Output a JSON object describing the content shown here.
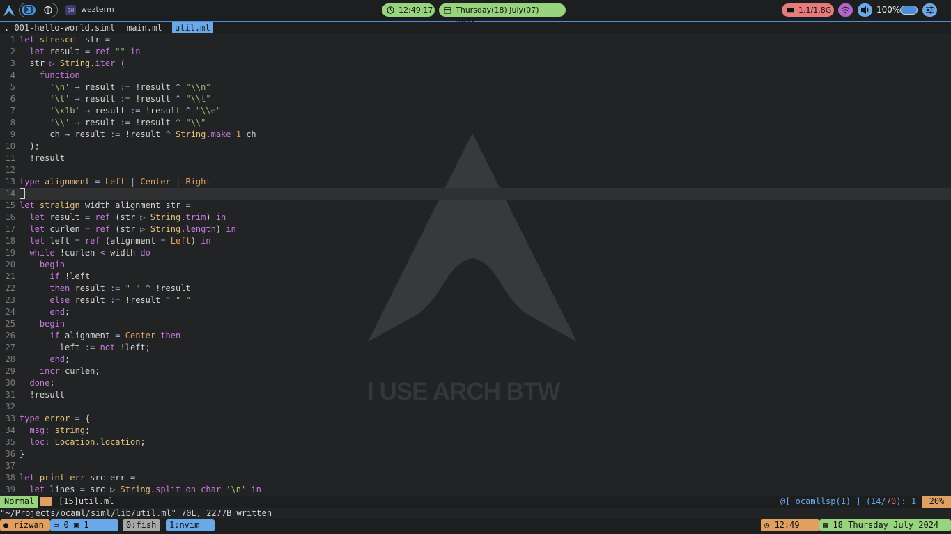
{
  "app": {
    "title": "wezterm",
    "icon_text": "$W"
  },
  "bar": {
    "clock": "12:49:17",
    "date": "Thursday(18) July(07) 2024",
    "memory": "1.1/1.8G",
    "battery": "100%",
    "icons": [
      "arch-logo-icon",
      "terminal-icon",
      "globe-icon",
      "clock-icon",
      "calendar-icon",
      "memory-icon",
      "wifi-icon",
      "volume-icon",
      "battery-icon",
      "settings-icon"
    ]
  },
  "tabs": [
    {
      "label": ".  001-hello-world.siml"
    },
    {
      "label": "main.ml"
    },
    {
      "label": "util.ml",
      "active": true
    }
  ],
  "colors": {
    "accent": "#4a90d9",
    "green": "#98d37e",
    "orange": "#e0a060",
    "red": "#e57b7b",
    "purple": "#c678dd",
    "yellow": "#e5c07b"
  },
  "editor": {
    "lines": [
      [
        [
          "k",
          "let "
        ],
        [
          "t",
          "strescc"
        ],
        [
          "",
          "  str "
        ],
        [
          "o",
          "="
        ]
      ],
      [
        [
          "",
          "  "
        ],
        [
          "k",
          "let "
        ],
        [
          "",
          "result "
        ],
        [
          "o",
          "= "
        ],
        [
          "k",
          "ref "
        ],
        [
          "s",
          "\"\""
        ],
        [
          "k",
          " in"
        ]
      ],
      [
        [
          "",
          "  str "
        ],
        [
          "o",
          "▷ "
        ],
        [
          "t",
          "String"
        ],
        [
          "",
          "."
        ],
        [
          "k",
          "iter"
        ],
        [
          "",
          ""
        ],
        [
          "o",
          " ("
        ]
      ],
      [
        [
          "",
          "    "
        ],
        [
          "k",
          "function"
        ]
      ],
      [
        [
          "",
          "    "
        ],
        [
          "o",
          "| "
        ],
        [
          "s",
          "'\\n'"
        ],
        [
          "o",
          " → "
        ],
        [
          "",
          "result "
        ],
        [
          "o",
          ":= "
        ],
        [
          "",
          "!result "
        ],
        [
          "o",
          "^ "
        ],
        [
          "s",
          "\"\\\\n\""
        ]
      ],
      [
        [
          "",
          "    "
        ],
        [
          "o",
          "| "
        ],
        [
          "s",
          "'\\t'"
        ],
        [
          "o",
          " → "
        ],
        [
          "",
          "result "
        ],
        [
          "o",
          ":= "
        ],
        [
          "",
          "!result "
        ],
        [
          "o",
          "^ "
        ],
        [
          "s",
          "\"\\\\t\""
        ]
      ],
      [
        [
          "",
          "    "
        ],
        [
          "o",
          "| "
        ],
        [
          "s",
          "'\\x1b'"
        ],
        [
          "o",
          " → "
        ],
        [
          "",
          "result "
        ],
        [
          "o",
          ":= "
        ],
        [
          "",
          "!result "
        ],
        [
          "o",
          "^ "
        ],
        [
          "s",
          "\"\\\\e\""
        ]
      ],
      [
        [
          "",
          "    "
        ],
        [
          "o",
          "| "
        ],
        [
          "s",
          "'\\\\'"
        ],
        [
          "o",
          " → "
        ],
        [
          "",
          "result "
        ],
        [
          "o",
          ":= "
        ],
        [
          "",
          "!result "
        ],
        [
          "o",
          "^ "
        ],
        [
          "s",
          "\"\\\\\""
        ]
      ],
      [
        [
          "",
          "    "
        ],
        [
          "o",
          "| "
        ],
        [
          "",
          "ch "
        ],
        [
          "o",
          "→ "
        ],
        [
          "",
          "result "
        ],
        [
          "o",
          ":= "
        ],
        [
          "",
          "!result "
        ],
        [
          "o",
          "^ "
        ],
        [
          "t",
          "String"
        ],
        [
          "",
          "."
        ],
        [
          "k",
          "make "
        ],
        [
          "c",
          "1"
        ],
        [
          "",
          " ch"
        ]
      ],
      [
        [
          "",
          "  );"
        ]
      ],
      [
        [
          "",
          "  !result"
        ]
      ],
      [],
      [
        [
          "k",
          "type "
        ],
        [
          "t",
          "alignment "
        ],
        [
          "o",
          "= "
        ],
        [
          "c",
          "Left "
        ],
        [
          "o",
          "| "
        ],
        [
          "c",
          "Center "
        ],
        [
          "o",
          "| "
        ],
        [
          "c",
          "Right"
        ]
      ],
      [],
      [
        [
          "k",
          "let "
        ],
        [
          "t",
          "stralign "
        ],
        [
          "",
          "width alignment str "
        ],
        [
          "o",
          "="
        ]
      ],
      [
        [
          "",
          "  "
        ],
        [
          "k",
          "let "
        ],
        [
          "",
          "result "
        ],
        [
          "o",
          "= "
        ],
        [
          "k",
          "ref "
        ],
        [
          "",
          "(str "
        ],
        [
          "o",
          "▷ "
        ],
        [
          "t",
          "String"
        ],
        [
          "",
          "."
        ],
        [
          "k",
          "trim"
        ],
        [
          "",
          ") "
        ],
        [
          "k",
          "in"
        ]
      ],
      [
        [
          "",
          "  "
        ],
        [
          "k",
          "let "
        ],
        [
          "",
          "curlen "
        ],
        [
          "o",
          "= "
        ],
        [
          "k",
          "ref "
        ],
        [
          "",
          "(str "
        ],
        [
          "o",
          "▷ "
        ],
        [
          "t",
          "String"
        ],
        [
          "",
          "."
        ],
        [
          "k",
          "length"
        ],
        [
          "",
          ") "
        ],
        [
          "k",
          "in"
        ]
      ],
      [
        [
          "",
          "  "
        ],
        [
          "k",
          "let "
        ],
        [
          "",
          "left "
        ],
        [
          "o",
          "= "
        ],
        [
          "k",
          "ref "
        ],
        [
          "",
          "(alignment "
        ],
        [
          "o",
          "= "
        ],
        [
          "c",
          "Left"
        ],
        [
          "",
          ") "
        ],
        [
          "k",
          "in"
        ]
      ],
      [
        [
          "",
          "  "
        ],
        [
          "k",
          "while "
        ],
        [
          "",
          "!curlen "
        ],
        [
          "o",
          "< "
        ],
        [
          "",
          "width "
        ],
        [
          "k",
          "do"
        ]
      ],
      [
        [
          "",
          "    "
        ],
        [
          "k",
          "begin"
        ]
      ],
      [
        [
          "",
          "      "
        ],
        [
          "k",
          "if "
        ],
        [
          "",
          "!left"
        ]
      ],
      [
        [
          "",
          "      "
        ],
        [
          "k",
          "then "
        ],
        [
          "",
          "result "
        ],
        [
          "o",
          ":= "
        ],
        [
          "s",
          "\" \" "
        ],
        [
          "o",
          "^ "
        ],
        [
          "",
          "!result"
        ]
      ],
      [
        [
          "",
          "      "
        ],
        [
          "k",
          "else "
        ],
        [
          "",
          "result "
        ],
        [
          "o",
          ":= "
        ],
        [
          "",
          "!result "
        ],
        [
          "o",
          "^ "
        ],
        [
          "s",
          "\" \""
        ]
      ],
      [
        [
          "",
          "      "
        ],
        [
          "k",
          "end"
        ],
        [
          "",
          ";"
        ]
      ],
      [
        [
          "",
          "    "
        ],
        [
          "k",
          "begin"
        ]
      ],
      [
        [
          "",
          "      "
        ],
        [
          "k",
          "if "
        ],
        [
          "",
          "alignment "
        ],
        [
          "o",
          "= "
        ],
        [
          "c",
          "Center "
        ],
        [
          "k",
          "then"
        ]
      ],
      [
        [
          "",
          "        left "
        ],
        [
          "o",
          ":= "
        ],
        [
          "k",
          "not "
        ],
        [
          "",
          "!left;"
        ]
      ],
      [
        [
          "",
          "      "
        ],
        [
          "k",
          "end"
        ],
        [
          "",
          ";"
        ]
      ],
      [
        [
          "",
          "    "
        ],
        [
          "k",
          "incr "
        ],
        [
          "",
          "curlen;"
        ]
      ],
      [
        [
          "",
          "  "
        ],
        [
          "k",
          "done"
        ],
        [
          "",
          ";"
        ]
      ],
      [
        [
          "",
          "  !result"
        ]
      ],
      [],
      [
        [
          "k",
          "type "
        ],
        [
          "t",
          "error "
        ],
        [
          "o",
          "= "
        ],
        [
          "",
          "{"
        ]
      ],
      [
        [
          "",
          "  "
        ],
        [
          "k",
          "msg"
        ],
        [
          "",
          ": "
        ],
        [
          "t",
          "string"
        ],
        [
          "",
          ";"
        ]
      ],
      [
        [
          "",
          "  "
        ],
        [
          "k",
          "loc"
        ],
        [
          "",
          ": "
        ],
        [
          "t",
          "Location"
        ],
        [
          "",
          "."
        ],
        [
          "t",
          "location"
        ],
        [
          "",
          ";"
        ]
      ],
      [
        [
          "",
          "}"
        ]
      ],
      [],
      [
        [
          "k",
          "let "
        ],
        [
          "t",
          "print_err "
        ],
        [
          "",
          "src err "
        ],
        [
          "o",
          "="
        ]
      ],
      [
        [
          "",
          "  "
        ],
        [
          "k",
          "let "
        ],
        [
          "",
          "lines "
        ],
        [
          "o",
          "= "
        ],
        [
          "",
          "src "
        ],
        [
          "o",
          "▷ "
        ],
        [
          "t",
          "String"
        ],
        [
          "",
          "."
        ],
        [
          "k",
          "split_on_char "
        ],
        [
          "s",
          "'\\n' "
        ],
        [
          "k",
          "in"
        ]
      ]
    ],
    "line_numbers": [
      "1",
      "2",
      "3",
      "4",
      "5",
      "6",
      "7",
      "8",
      "9",
      "10",
      "11",
      "12",
      "13",
      "14",
      "15",
      "16",
      "17",
      "18",
      "19",
      "20",
      "21",
      "22",
      "23",
      "24",
      "25",
      "26",
      "27",
      "28",
      "29",
      "30",
      "31",
      "32",
      "33",
      "34",
      "35",
      "36",
      "37",
      "38",
      "39"
    ],
    "cursor_line": 14
  },
  "wallpaper_text": "I USE ARCH BTW",
  "status": {
    "mode": "Normal",
    "file": "[15]util.ml",
    "lsp_prefix": "@[ ocamllsp(1) ] (",
    "line": "14",
    "slash": "/",
    "total": "70",
    "lsp_suffix": "):  1",
    "percent": "20%"
  },
  "message": "\"~/Projects/ocaml/siml/lib/util.ml\" 70L, 2277B written",
  "tmux": {
    "user": "rizwan",
    "session": "0",
    "pane": "1",
    "windows": [
      "0:fish",
      "1:nvim"
    ],
    "time": "12:49",
    "date": "18 Thursday July 2024"
  }
}
